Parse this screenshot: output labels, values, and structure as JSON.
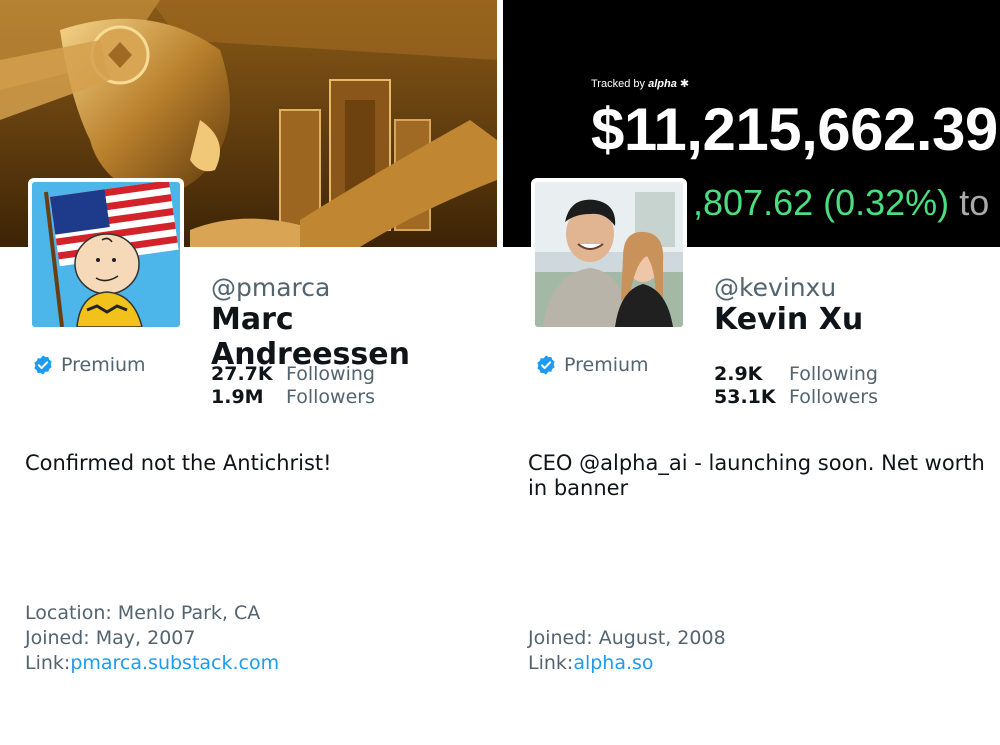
{
  "profiles": [
    {
      "handle": "@pmarca",
      "name": "Marc Andreessen",
      "badge": "Premium",
      "following_count": "27.7K",
      "following_label": "Following",
      "followers_count": "1.9M",
      "followers_label": "Followers",
      "bio": "Confirmed not the Antichrist!",
      "location": "Location: Menlo Park, CA",
      "joined": "Joined: May, 2007",
      "link_label": "Link:",
      "link_url": "pmarca.substack.com",
      "banner": "gold-statue-image",
      "avatar": "flag-cartoon-image"
    },
    {
      "handle": "@kevinxu",
      "name": "Kevin Xu",
      "badge": "Premium",
      "following_count": "2.9K",
      "following_label": "Following",
      "followers_count": "53.1K",
      "followers_label": "Followers",
      "bio": "CEO @alpha_ai - launching soon. Net worth in banner",
      "joined": "Joined: August, 2008",
      "link_label": "Link:",
      "link_url": "alpha.so",
      "banner": "net-worth-banner",
      "banner_tracked_prefix": "Tracked by",
      "banner_tracked_brand": "alpha",
      "banner_amount": "$11,215,662.39",
      "banner_change": ",807.62 (0.32%)",
      "banner_change_tail": "to",
      "avatar": "couple-photo"
    }
  ],
  "colors": {
    "verified": "#1d9bf0",
    "link": "#1d9bf0",
    "muted": "#536471",
    "gain": "#4ade80"
  }
}
